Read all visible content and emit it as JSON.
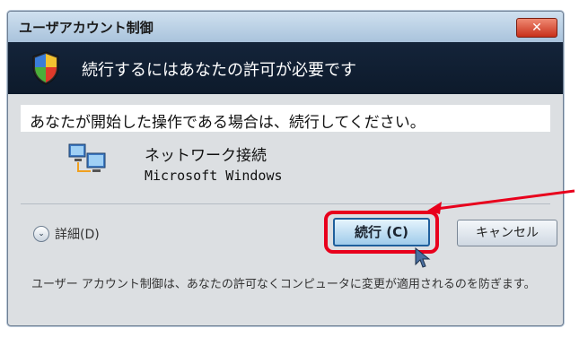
{
  "window": {
    "title": "ユーザアカウント制御",
    "close_glyph": "✕"
  },
  "header": {
    "text": "続行するにはあなたの許可が必要です"
  },
  "instruction": {
    "text": "あなたが開始した操作である場合は、続行してください。"
  },
  "program": {
    "name": "ネットワーク接続",
    "publisher": "Microsoft Windows"
  },
  "details": {
    "label": "詳細(D)",
    "chevron": "⌄"
  },
  "buttons": {
    "continue_label": "続行 (C)",
    "cancel_label": "キャンセル"
  },
  "footer": {
    "text": "ユーザー アカウント制御は、あなたの許可なくコンピュータに変更が適用されるのを防ぎます。"
  },
  "colors": {
    "annotation_red": "#e8001c",
    "header_band": "#14243a"
  }
}
